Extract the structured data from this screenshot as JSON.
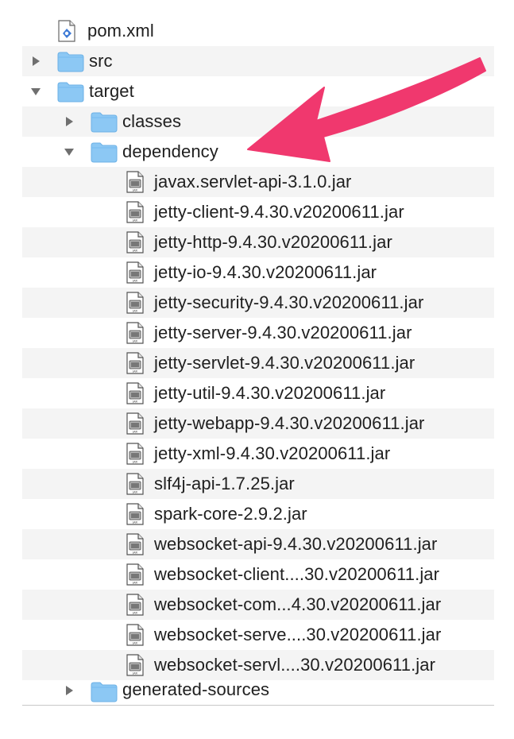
{
  "tree": {
    "items": [
      {
        "label": "pom.xml",
        "kind": "xml-file",
        "icon": "xml-file-icon",
        "level": 0,
        "expandable": false
      },
      {
        "label": "src",
        "kind": "folder",
        "icon": "folder-icon",
        "level": 0,
        "expandable": true,
        "expanded": false
      },
      {
        "label": "target",
        "kind": "folder",
        "icon": "folder-icon",
        "level": 0,
        "expandable": true,
        "expanded": true
      },
      {
        "label": "classes",
        "kind": "folder",
        "icon": "folder-icon",
        "level": 1,
        "expandable": true,
        "expanded": false
      },
      {
        "label": "dependency",
        "kind": "folder",
        "icon": "folder-icon",
        "level": 1,
        "expandable": true,
        "expanded": true
      },
      {
        "label": "javax.servlet-api-3.1.0.jar",
        "kind": "jar",
        "icon": "jar-file-icon",
        "level": 2
      },
      {
        "label": "jetty-client-9.4.30.v20200611.jar",
        "kind": "jar",
        "icon": "jar-file-icon",
        "level": 2
      },
      {
        "label": "jetty-http-9.4.30.v20200611.jar",
        "kind": "jar",
        "icon": "jar-file-icon",
        "level": 2
      },
      {
        "label": "jetty-io-9.4.30.v20200611.jar",
        "kind": "jar",
        "icon": "jar-file-icon",
        "level": 2
      },
      {
        "label": "jetty-security-9.4.30.v20200611.jar",
        "kind": "jar",
        "icon": "jar-file-icon",
        "level": 2
      },
      {
        "label": "jetty-server-9.4.30.v20200611.jar",
        "kind": "jar",
        "icon": "jar-file-icon",
        "level": 2
      },
      {
        "label": "jetty-servlet-9.4.30.v20200611.jar",
        "kind": "jar",
        "icon": "jar-file-icon",
        "level": 2
      },
      {
        "label": "jetty-util-9.4.30.v20200611.jar",
        "kind": "jar",
        "icon": "jar-file-icon",
        "level": 2
      },
      {
        "label": "jetty-webapp-9.4.30.v20200611.jar",
        "kind": "jar",
        "icon": "jar-file-icon",
        "level": 2
      },
      {
        "label": "jetty-xml-9.4.30.v20200611.jar",
        "kind": "jar",
        "icon": "jar-file-icon",
        "level": 2
      },
      {
        "label": "slf4j-api-1.7.25.jar",
        "kind": "jar",
        "icon": "jar-file-icon",
        "level": 2
      },
      {
        "label": "spark-core-2.9.2.jar",
        "kind": "jar",
        "icon": "jar-file-icon",
        "level": 2
      },
      {
        "label": "websocket-api-9.4.30.v20200611.jar",
        "kind": "jar",
        "icon": "jar-file-icon",
        "level": 2
      },
      {
        "label": "websocket-client....30.v20200611.jar",
        "kind": "jar",
        "icon": "jar-file-icon",
        "level": 2
      },
      {
        "label": "websocket-com...4.30.v20200611.jar",
        "kind": "jar",
        "icon": "jar-file-icon",
        "level": 2
      },
      {
        "label": "websocket-serve....30.v20200611.jar",
        "kind": "jar",
        "icon": "jar-file-icon",
        "level": 2
      },
      {
        "label": "websocket-servl....30.v20200611.jar",
        "kind": "jar",
        "icon": "jar-file-icon",
        "level": 2
      },
      {
        "label": "generated-sources",
        "kind": "folder",
        "icon": "folder-icon",
        "level": 1,
        "expandable": true,
        "expanded": false
      }
    ]
  },
  "annotation": {
    "icon": "pointer-arrow-icon",
    "color": "#f0386e"
  },
  "colors": {
    "folder": "#8cc8f4",
    "folder_tab": "#79bdf0",
    "stripe": "#f4f4f4",
    "text": "#202020",
    "disclosure": "#6f6f6f"
  }
}
